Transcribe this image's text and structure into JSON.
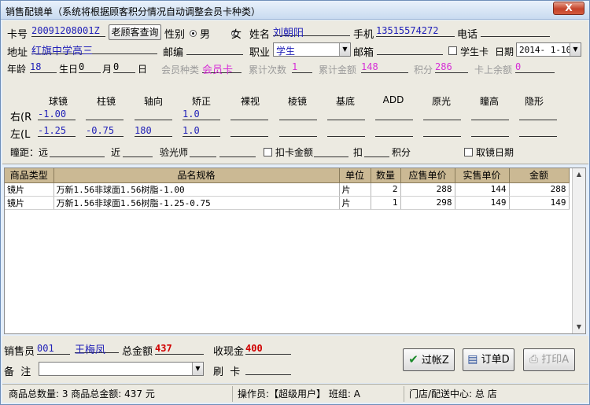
{
  "window": {
    "title": "销售配镜单（系统将根据顾客积分情况自动调整会员卡种类）",
    "close_label": "X"
  },
  "customer": {
    "card_no_label": "卡号",
    "card_no": "20091208001Z",
    "old_customer_button": "老顾客查询",
    "gender_label": "性别",
    "gender_male": "男",
    "gender_female": "女",
    "gender_selected": "男",
    "name_label": "姓名",
    "name": "刘朝阳",
    "mobile_label": "手机",
    "mobile": "13515574272",
    "phone_label": "电话",
    "phone": "",
    "address_label": "地址",
    "address": "红旗中学高三",
    "postcode_label": "邮编",
    "postcode": "",
    "job_label": "职业",
    "job": "学生",
    "email_label": "邮箱",
    "email": "",
    "student_card_label": "学生卡",
    "date_label": "日期",
    "date": "2014- 1-10",
    "age_label": "年龄",
    "age": "18",
    "birthday_label": "生日",
    "birth_year": "0",
    "birth_month_label": "月",
    "birth_month": "0",
    "birth_day_label": "日",
    "member_type_label": "会员种类",
    "member_type": "会员卡",
    "visit_count_label": "累计次数",
    "visit_count": "1",
    "total_amount_label": "累计金额",
    "total_amount": "148",
    "points_label": "积分",
    "points": "286",
    "card_balance_label": "卡上余额",
    "card_balance": "0"
  },
  "prescription": {
    "headers": [
      "球镜",
      "柱镜",
      "轴向",
      "矫正",
      "裸视",
      "棱镜",
      "基底",
      "ADD",
      "原光",
      "瞳高",
      "隐形"
    ],
    "right_label": "右(R",
    "left_label": "左(L",
    "right": [
      "-1.00",
      "",
      "",
      "1.0",
      "",
      "",
      "",
      "",
      "",
      "",
      ""
    ],
    "left": [
      "-1.25",
      "-0.75",
      "180",
      "1.0",
      "",
      "",
      "",
      "",
      "",
      "",
      ""
    ]
  },
  "extras": {
    "pd_label": "瞳距：远",
    "near_label": "近",
    "optometrist_label": "验光师",
    "deduct_card_label": "扣卡金额",
    "deduct_label": "扣",
    "points_unit": "积分",
    "pickup_date_label": "取镜日期"
  },
  "grid": {
    "columns": [
      "商品类型",
      "品名规格",
      "单位",
      "数量",
      "应售单价",
      "实售单价",
      "金额"
    ],
    "rows": [
      {
        "type": "镜片",
        "name": "万新1.56非球面1.56树脂-1.00",
        "unit": "片",
        "qty": "2",
        "list_price": "288",
        "sale_price": "144",
        "amount": "288"
      },
      {
        "type": "镜片",
        "name": "万新1.56非球面1.56树脂-1.25-0.75",
        "unit": "片",
        "qty": "1",
        "list_price": "298",
        "sale_price": "149",
        "amount": "149"
      }
    ]
  },
  "footer": {
    "salesperson_label": "销售员",
    "salesperson_id": "001",
    "salesperson_name": "王梅凤",
    "total_label": "总金额",
    "total": "437",
    "cash_label": "收现金",
    "cash": "400",
    "remark_label": "备  注",
    "swipe_label": "刷  卡",
    "post_button": "过帐Z",
    "order_button": "订单D",
    "print_button": "打印A"
  },
  "status": {
    "summary": "商品总数量: 3 商品总金额: 437 元",
    "operator": "操作员:【超级用户】 班组: A",
    "store": "门店/配送中心: 总  店"
  }
}
